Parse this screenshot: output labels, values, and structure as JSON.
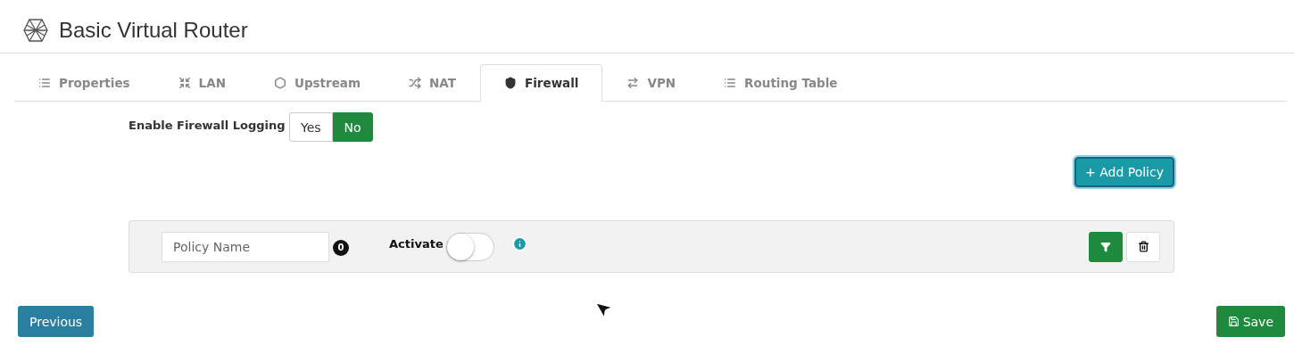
{
  "window": {
    "title": "Basic Virtual Router"
  },
  "tabs": [
    {
      "label": "Properties",
      "selected": false
    },
    {
      "label": "LAN",
      "selected": false
    },
    {
      "label": "Upstream",
      "selected": false
    },
    {
      "label": "NAT",
      "selected": false
    },
    {
      "label": "Firewall",
      "selected": true
    },
    {
      "label": "VPN",
      "selected": false
    },
    {
      "label": "Routing Table",
      "selected": false
    }
  ],
  "logging": {
    "label": "Enable Firewall Logging",
    "options": [
      {
        "label": "Yes",
        "selected": false
      },
      {
        "label": "No",
        "selected": true
      }
    ]
  },
  "add_button": "+ Add Policy",
  "policy": {
    "placeholder": "Policy Name",
    "count": "0",
    "activate_label": "Activate",
    "on": false
  },
  "footer": {
    "previous": "Previous",
    "save": "Save"
  }
}
